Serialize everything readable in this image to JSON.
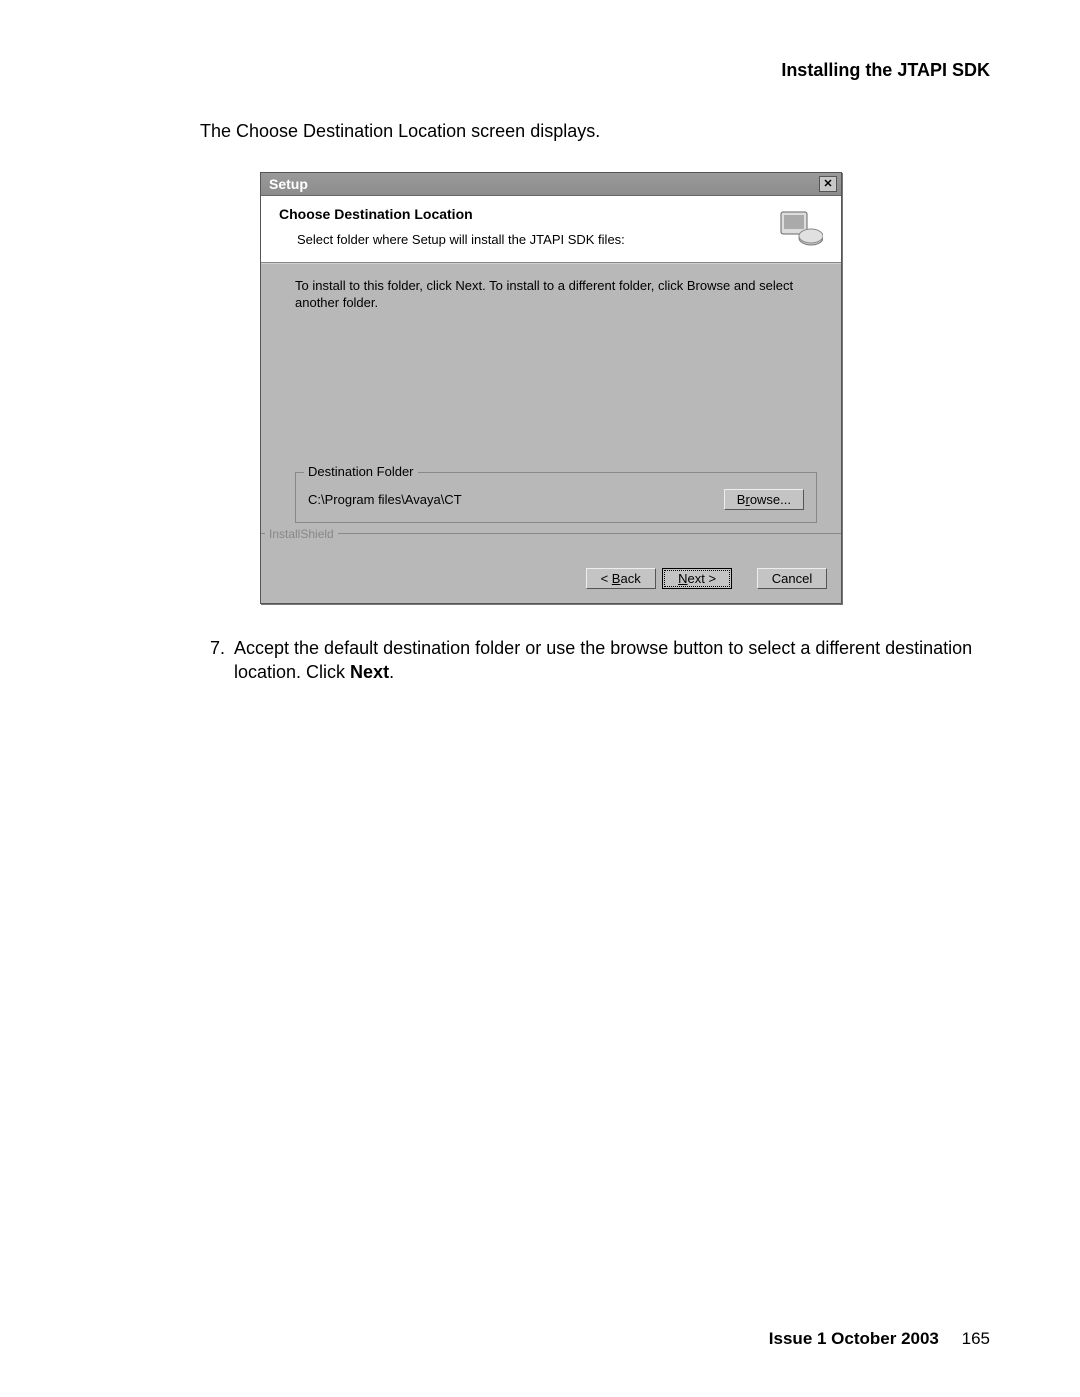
{
  "header": "Installing the JTAPI SDK",
  "intro": "The Choose Destination Location screen displays.",
  "dialog": {
    "title": "Setup",
    "heading": "Choose Destination Location",
    "subheading": "Select folder where Setup will install the JTAPI SDK files:",
    "instruction": "To install to this folder, click Next. To install to a different folder, click Browse and select another folder.",
    "group_label": "Destination Folder",
    "dest_path": "C:\\Program files\\Avaya\\CT",
    "browse_label": "Browse...",
    "brand": "InstallShield",
    "back_label": "< Back",
    "next_label": "Next >",
    "cancel_label": "Cancel"
  },
  "step": {
    "number": "7.",
    "text_pre": "Accept the default destination folder or use the browse button to select a different destination location. Click ",
    "text_bold": "Next",
    "text_post": "."
  },
  "footer": {
    "issue": "Issue 1   October 2003",
    "page": "165"
  }
}
